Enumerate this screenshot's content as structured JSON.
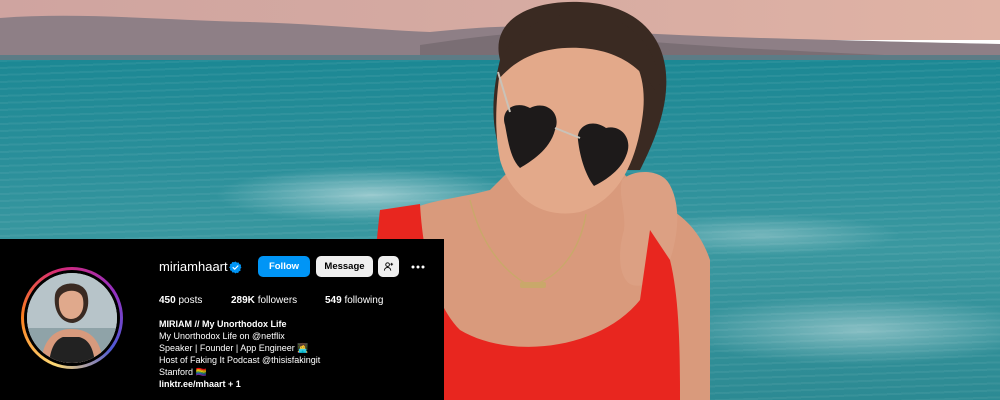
{
  "profile": {
    "username": "miriamhaart",
    "verified": true,
    "follow_label": "Follow",
    "message_label": "Message",
    "stats": {
      "posts_count": "450",
      "posts_label": "posts",
      "followers_count": "289K",
      "followers_label": "followers",
      "following_count": "549",
      "following_label": "following"
    },
    "bio": {
      "name": "MIRIAM // My Unorthodox Life",
      "lines": [
        "My Unorthodox Life on @netflix",
        "Speaker | Founder | App Engineer 👩‍💻",
        "Host of Faking It Podcast @thisisfakingit",
        "Stanford 🏳️‍🌈"
      ],
      "link": "linktr.ee/mhaart + 1"
    }
  },
  "colors": {
    "panel_bg": "#000000",
    "follow_bg": "#0095f6",
    "secondary_btn_bg": "#efefef",
    "verified_badge": "#0095f6"
  },
  "icons": {
    "verified": "verified-badge-icon",
    "suggest": "add-person-icon",
    "more": "more-horizontal-icon"
  }
}
